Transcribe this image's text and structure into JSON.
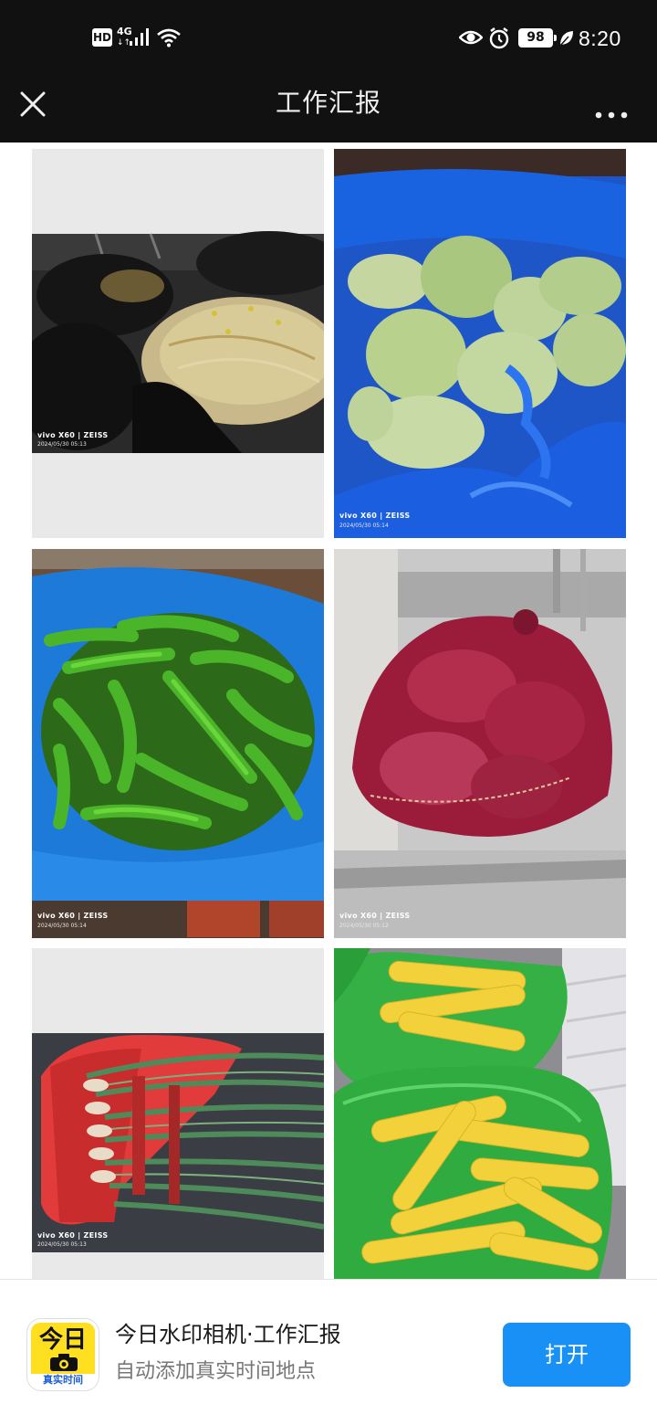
{
  "status_bar": {
    "hd_label": "HD",
    "network": "4G",
    "network_arrows": "↓↑",
    "battery": "98",
    "time": "8:20"
  },
  "title_bar": {
    "title": "工作汇报"
  },
  "photos": [
    {
      "subject": "bean sprouts in black bags",
      "brand": "vivo X60 | ZEISS",
      "timestamp": "2024/05/30 05:13"
    },
    {
      "subject": "cabbages in blue bag",
      "brand": "vivo X60 | ZEISS",
      "timestamp": "2024/05/30 05:14"
    },
    {
      "subject": "green peppers in blue bag",
      "brand": "vivo X60 | ZEISS",
      "timestamp": "2024/05/30 05:14"
    },
    {
      "subject": "red onion net bag",
      "brand": "vivo X60 | ZEISS",
      "timestamp": "2024/05/30 05:12"
    },
    {
      "subject": "garlic chives in red bag",
      "brand": "vivo X60 | ZEISS",
      "timestamp": "2024/05/30 05:13"
    },
    {
      "subject": "corn cobs in green bags",
      "brand": "",
      "timestamp": ""
    }
  ],
  "app_banner": {
    "logo_text": "今日",
    "logo_sub": "真实时间",
    "app_name": "今日水印相机·工作汇报",
    "description": "自动添加真实时间地点",
    "open_label": "打开",
    "accent_color": "#1890f5"
  }
}
